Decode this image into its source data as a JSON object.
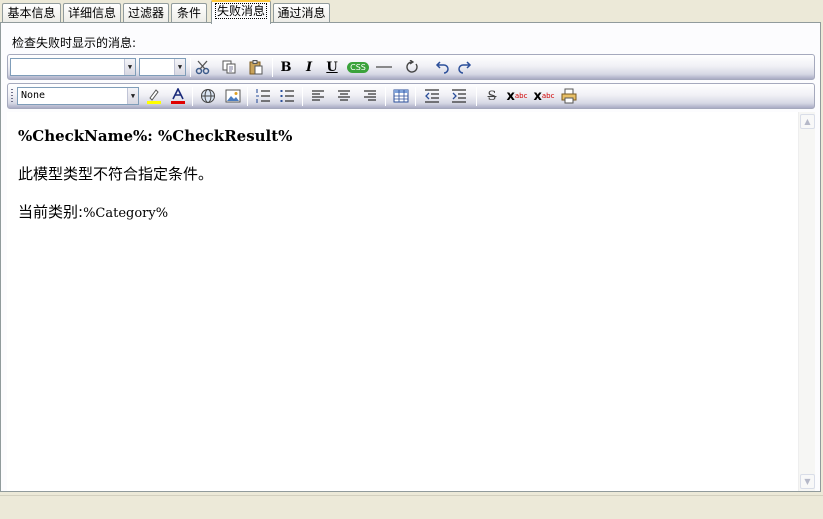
{
  "tabs": [
    {
      "label": "基本信息",
      "active": false
    },
    {
      "label": "详细信息",
      "active": false
    },
    {
      "label": "过滤器",
      "active": false
    },
    {
      "label": "条件",
      "active": false
    },
    {
      "label": "失败消息",
      "active": true
    },
    {
      "label": "通过消息",
      "active": false
    }
  ],
  "prompt": "检查失败时显示的消息:",
  "toolbar": {
    "font_name_value": "",
    "font_size_value": "",
    "style_value": "None",
    "bold": "B",
    "italic": "I",
    "underline": "U",
    "css_badge": "CSS",
    "strike": "S",
    "superscript_text": "abc",
    "subscript_text": "abc",
    "css_badge_color": "#3aa23a"
  },
  "editor": {
    "line1": "%CheckName%: %CheckResult%",
    "line2": "此模型类型不符合指定条件。",
    "line3_label": "当前类别:",
    "line3_var": "%Category%"
  }
}
